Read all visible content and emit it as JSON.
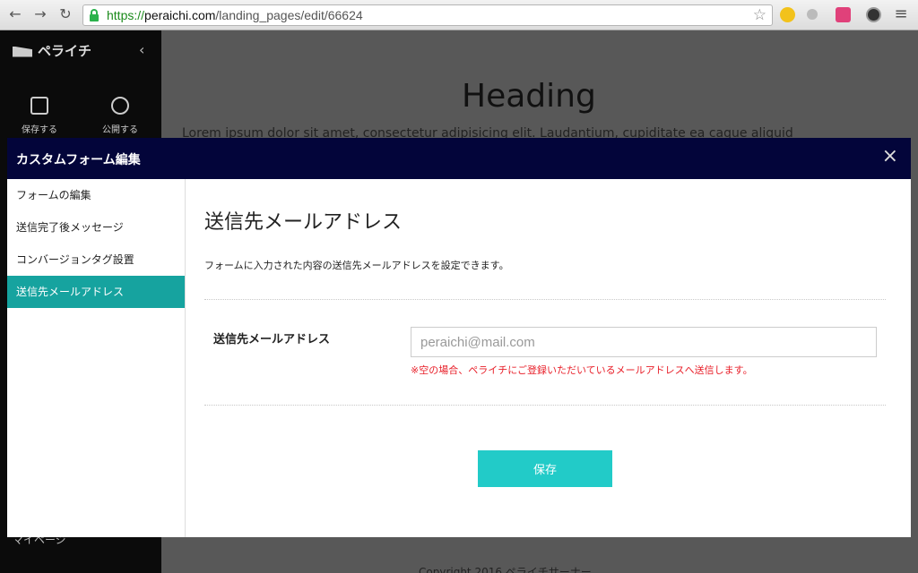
{
  "browser": {
    "url_scheme": "https://",
    "url_host": "peraichi.com",
    "url_path": "/landing_pages/edit/66624"
  },
  "app": {
    "logo": "ペライチ",
    "tools": [
      {
        "label": "保存する",
        "icon": "floppy-disk-icon"
      },
      {
        "label": "公開する",
        "icon": "globe-icon"
      }
    ],
    "mypage": "マイページ",
    "page_heading": "Heading",
    "page_lorem": "Lorem ipsum dolor sit amet, consectetur adipisicing elit. Laudantium, cupiditate ea caque aliquid",
    "copyright": "Copyright 2016 ペライチサーナー"
  },
  "modal": {
    "title": "カスタムフォーム編集",
    "close_icon": "×",
    "menu": [
      {
        "label": "フォームの編集",
        "active": false
      },
      {
        "label": "送信完了後メッセージ",
        "active": false
      },
      {
        "label": "コンバージョンタグ設置",
        "active": false
      },
      {
        "label": "送信先メールアドレス",
        "active": true
      }
    ],
    "content": {
      "title": "送信先メールアドレス",
      "description": "フォームに入力された内容の送信先メールアドレスを設定できます。",
      "field_label": "送信先メールアドレス",
      "field_placeholder": "peraichi@mail.com",
      "field_note": "※空の場合、ペライチにご登録いただいているメールアドレスへ送信します。",
      "save_label": "保存"
    }
  },
  "colors": {
    "modal_header": "#03053a",
    "active_menu": "#16a39f",
    "save_button": "#22cbc8",
    "note_red": "#e8202a"
  }
}
